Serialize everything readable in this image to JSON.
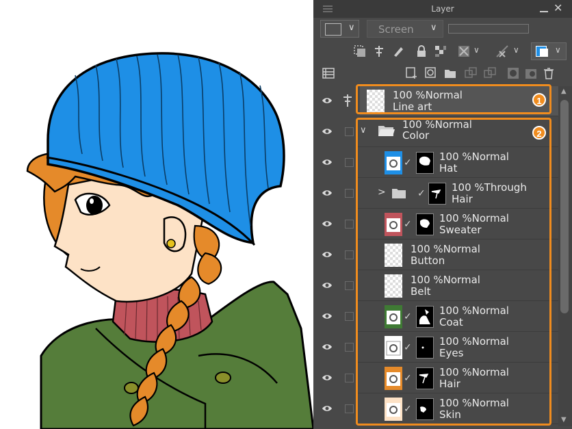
{
  "panel": {
    "title": "Layer",
    "blend_mode": "Screen",
    "close_glyph": "✕"
  },
  "layers": [
    {
      "id": "line-art",
      "opacity": "100 %",
      "mode": "Normal",
      "name": "Line art",
      "type": "raster",
      "thumb": "checker",
      "visible": true
    },
    {
      "id": "color-folder",
      "opacity": "100 %",
      "mode": "Normal",
      "name": "Color",
      "type": "folder",
      "expanded": true,
      "visible": true
    },
    {
      "id": "hat",
      "opacity": "100 %",
      "mode": "Normal",
      "name": "Hat",
      "type": "fill",
      "fill_color": "#1e8fe6",
      "mask": true,
      "visible": true
    },
    {
      "id": "hair-folder",
      "opacity": "100 %",
      "mode": "Through",
      "name": "Hair",
      "type": "folder",
      "expanded": false,
      "mask": true,
      "visible": true
    },
    {
      "id": "sweater",
      "opacity": "100 %",
      "mode": "Normal",
      "name": "Sweater",
      "type": "fill",
      "fill_color": "#c0545c",
      "mask": true,
      "visible": true
    },
    {
      "id": "button",
      "opacity": "100 %",
      "mode": "Normal",
      "name": "Button",
      "type": "raster",
      "thumb": "checker",
      "visible": true
    },
    {
      "id": "belt",
      "opacity": "100 %",
      "mode": "Normal",
      "name": "Belt",
      "type": "raster",
      "thumb": "checker",
      "visible": true
    },
    {
      "id": "coat",
      "opacity": "100 %",
      "mode": "Normal",
      "name": "Coat",
      "type": "fill",
      "fill_color": "#3f7a34",
      "mask": true,
      "visible": true
    },
    {
      "id": "eyes",
      "opacity": "100 %",
      "mode": "Normal",
      "name": "Eyes",
      "type": "fill",
      "fill_color": "#ffffff",
      "mask": true,
      "visible": true
    },
    {
      "id": "hair",
      "opacity": "100 %",
      "mode": "Normal",
      "name": "Hair",
      "type": "fill",
      "fill_color": "#e58a2a",
      "mask": true,
      "visible": true
    },
    {
      "id": "skin",
      "opacity": "100 %",
      "mode": "Normal",
      "name": "Skin",
      "type": "fill",
      "fill_color": "#fde2c6",
      "mask": true,
      "visible": true
    }
  ],
  "annotations": {
    "badge_1": "1",
    "badge_2": "2",
    "highlight_color": "#f08c1e"
  },
  "illustration": {
    "hat_color": "#1e8fe6",
    "hair_color": "#e58a2a",
    "skin_color": "#fde2c6",
    "coat_color": "#3f7a34",
    "sweater_color": "#c0545c"
  }
}
